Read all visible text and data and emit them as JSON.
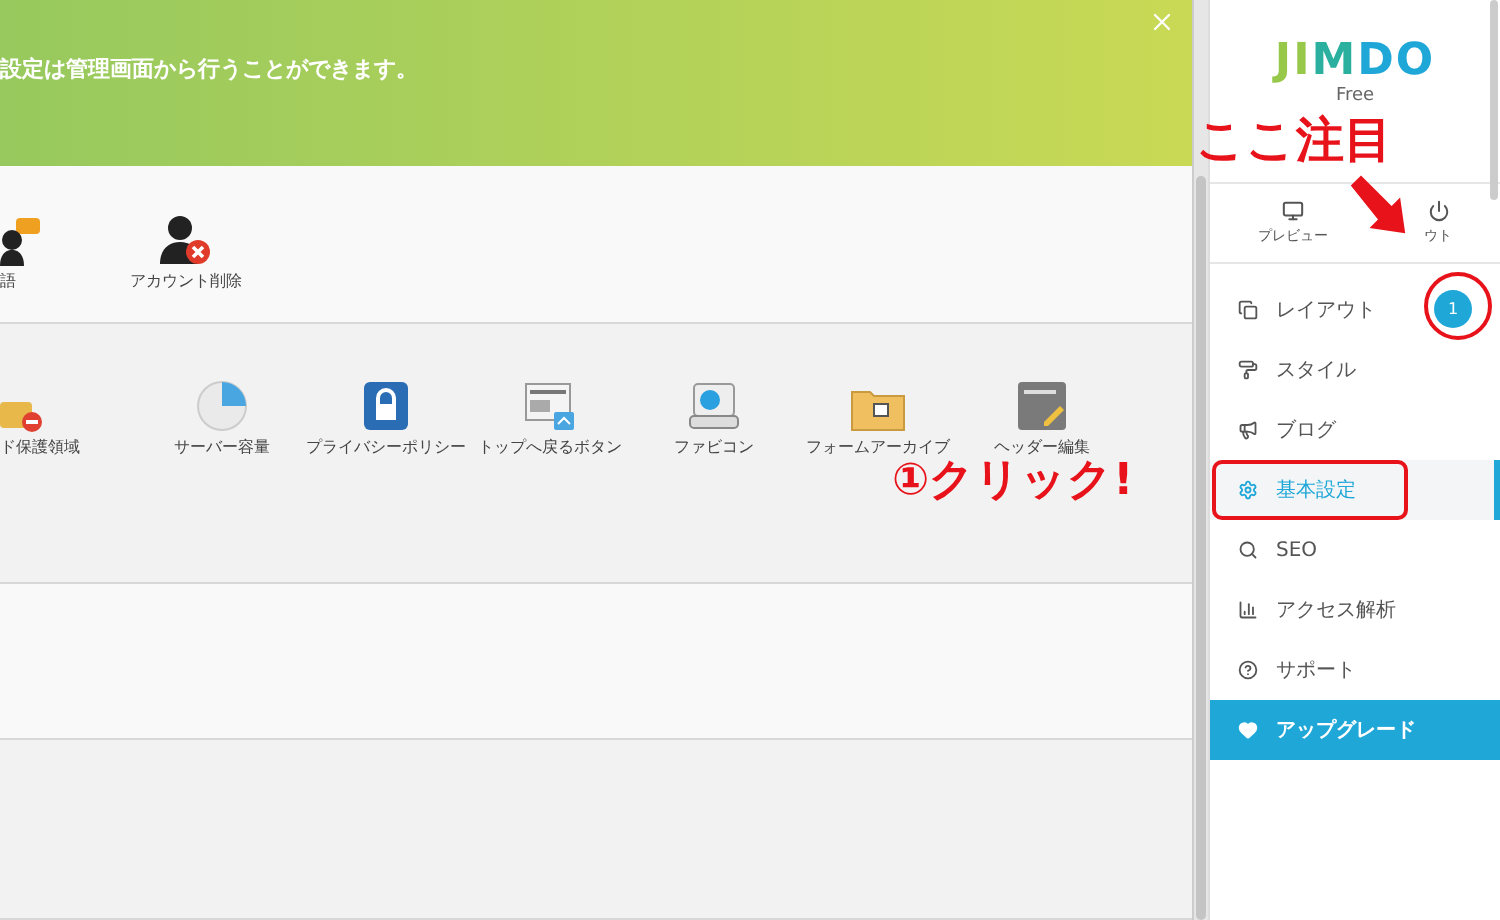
{
  "banner": {
    "message": "設定は管理画面から行うことができます。"
  },
  "sections": [
    {
      "items": [
        {
          "label": "語",
          "kind": "language"
        },
        {
          "label": "アカウント削除",
          "kind": "delete-account"
        }
      ]
    },
    {
      "items": [
        {
          "label": "ド保護領域",
          "kind": "password"
        },
        {
          "label": "サーバー容量",
          "kind": "server"
        },
        {
          "label": "プライバシーポリシー",
          "kind": "privacy"
        },
        {
          "label": "トップへ戻るボタン",
          "kind": "back-to-top"
        },
        {
          "label": "ファビコン",
          "kind": "favicon"
        },
        {
          "label": "フォームアーカイブ",
          "kind": "form-archive"
        },
        {
          "label": "ヘッダー編集",
          "kind": "header-edit"
        }
      ]
    }
  ],
  "sidebar": {
    "logo": "JIMDO",
    "plan": "Free",
    "actions": [
      {
        "label": "プレビュー",
        "kind": "preview"
      },
      {
        "label": "ウト",
        "kind": "logout"
      }
    ],
    "menu": [
      {
        "label": "レイアウト",
        "kind": "layout",
        "selected": false,
        "highlighted": false,
        "badge": "1"
      },
      {
        "label": "スタイル",
        "kind": "style",
        "selected": false,
        "highlighted": false
      },
      {
        "label": "ブログ",
        "kind": "blog",
        "selected": false,
        "highlighted": false
      },
      {
        "label": "基本設定",
        "kind": "settings",
        "selected": true,
        "highlighted": true
      },
      {
        "label": "SEO",
        "kind": "search",
        "selected": false,
        "highlighted": false
      },
      {
        "label": "アクセス解析",
        "kind": "stats",
        "selected": false,
        "highlighted": false
      },
      {
        "label": "サポート",
        "kind": "help",
        "selected": false,
        "highlighted": false
      },
      {
        "label": "アップグレード",
        "kind": "upgrade",
        "selected": false,
        "highlighted": false
      }
    ]
  },
  "annotations": {
    "note": "ここ注目",
    "click": "①クリック!"
  }
}
